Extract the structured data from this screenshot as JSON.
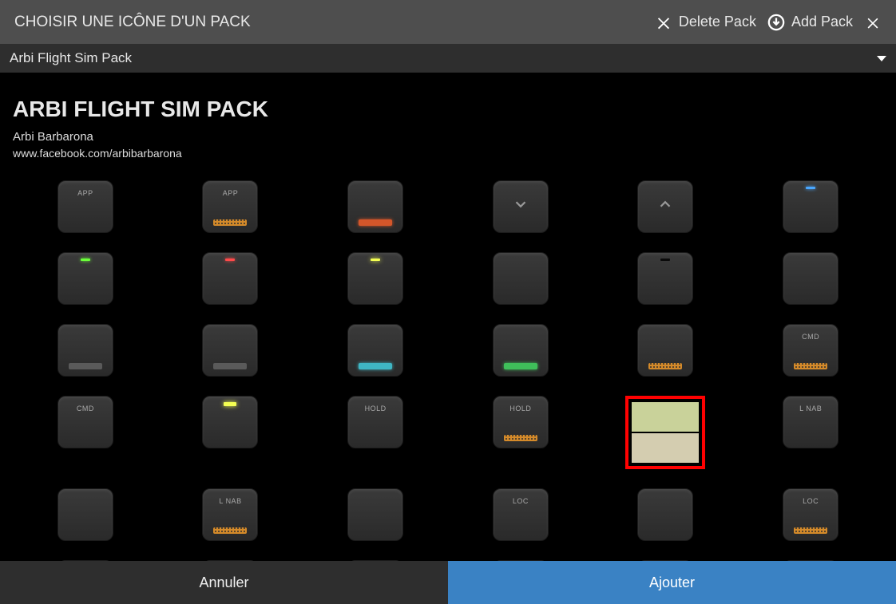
{
  "header": {
    "title": "CHOISIR UNE ICÔNE D'UN PACK",
    "delete_label": "Delete Pack",
    "add_label": "Add Pack"
  },
  "subheader": {
    "pack_name": "Arbi Flight Sim Pack"
  },
  "pack": {
    "title": "ARBI FLIGHT SIM PACK",
    "author": "Arbi Barbarona",
    "link": "www.facebook.com/arbibarbarona"
  },
  "grid": [
    {
      "label": "APP",
      "dots": "",
      "led": "",
      "arrow": "",
      "selected": false
    },
    {
      "label": "APP",
      "dots": "dots-orange",
      "led": "",
      "arrow": "",
      "selected": false
    },
    {
      "label": "",
      "dots": "dots-orangered",
      "led": "",
      "arrow": "",
      "selected": false
    },
    {
      "label": "",
      "dots": "",
      "led": "",
      "arrow": "down",
      "selected": false
    },
    {
      "label": "",
      "dots": "",
      "led": "",
      "arrow": "up",
      "selected": false
    },
    {
      "label": "",
      "dots": "",
      "led": "led-blue",
      "arrow": "",
      "selected": false
    },
    {
      "label": "",
      "dots": "",
      "led": "led-green",
      "arrow": "",
      "selected": false
    },
    {
      "label": "",
      "dots": "",
      "led": "led-red",
      "arrow": "",
      "selected": false
    },
    {
      "label": "",
      "dots": "",
      "led": "led-yellow",
      "arrow": "",
      "selected": false
    },
    {
      "label": "",
      "dots": "",
      "led": "",
      "arrow": "",
      "selected": false
    },
    {
      "label": "",
      "dots": "",
      "led": "led-black",
      "arrow": "",
      "selected": false
    },
    {
      "label": "",
      "dots": "",
      "led": "",
      "arrow": "",
      "selected": false
    },
    {
      "label": "",
      "dots": "dots-gray",
      "led": "",
      "arrow": "",
      "selected": false
    },
    {
      "label": "",
      "dots": "dots-gray",
      "led": "",
      "arrow": "",
      "selected": false
    },
    {
      "label": "",
      "dots": "dots-cyan",
      "led": "",
      "arrow": "",
      "selected": false
    },
    {
      "label": "",
      "dots": "dots-green",
      "led": "",
      "arrow": "",
      "selected": false
    },
    {
      "label": "",
      "dots": "dots-orange",
      "led": "",
      "arrow": "",
      "selected": false
    },
    {
      "label": "CMD",
      "dots": "dots-orange",
      "led": "",
      "arrow": "",
      "selected": false
    },
    {
      "label": "CMD",
      "dots": "",
      "led": "",
      "arrow": "",
      "selected": false
    },
    {
      "label": "",
      "dots": "",
      "led": "led-yellow",
      "arrow": "",
      "selected": false,
      "ledwide": true
    },
    {
      "label": "HOLD",
      "dots": "",
      "led": "",
      "arrow": "",
      "selected": false
    },
    {
      "label": "HOLD",
      "dots": "dots-orange",
      "led": "",
      "arrow": "",
      "selected": false
    },
    {
      "label": "",
      "dots": "",
      "led": "",
      "arrow": "",
      "selected": true
    },
    {
      "label": "L NAB",
      "dots": "",
      "led": "",
      "arrow": "",
      "selected": false
    },
    {
      "label": "",
      "dots": "",
      "led": "",
      "arrow": "",
      "selected": false
    },
    {
      "label": "L NAB",
      "dots": "dots-orange",
      "led": "",
      "arrow": "",
      "selected": false
    },
    {
      "label": "",
      "dots": "",
      "led": "",
      "arrow": "",
      "selected": false
    },
    {
      "label": "LOC",
      "dots": "",
      "led": "",
      "arrow": "",
      "selected": false
    },
    {
      "label": "",
      "dots": "",
      "led": "",
      "arrow": "",
      "selected": false
    },
    {
      "label": "LOC",
      "dots": "dots-orange",
      "led": "",
      "arrow": "",
      "selected": false
    },
    {
      "label": "",
      "dots": "",
      "led": "",
      "arrow": "",
      "selected": false,
      "partial": true
    },
    {
      "label": "",
      "dots": "",
      "led": "",
      "arrow": "",
      "selected": false,
      "partial": true
    },
    {
      "label": "",
      "dots": "",
      "led": "",
      "arrow": "",
      "selected": false,
      "partial": true
    },
    {
      "label": "",
      "dots": "",
      "led": "",
      "arrow": "",
      "selected": false,
      "partial": true
    },
    {
      "label": "",
      "dots": "",
      "led": "led-orange",
      "arrow": "",
      "selected": false,
      "partial": true
    },
    {
      "label": "",
      "dots": "",
      "led": "",
      "arrow": "",
      "selected": false,
      "partial": true
    }
  ],
  "footer": {
    "cancel": "Annuler",
    "add": "Ajouter"
  }
}
